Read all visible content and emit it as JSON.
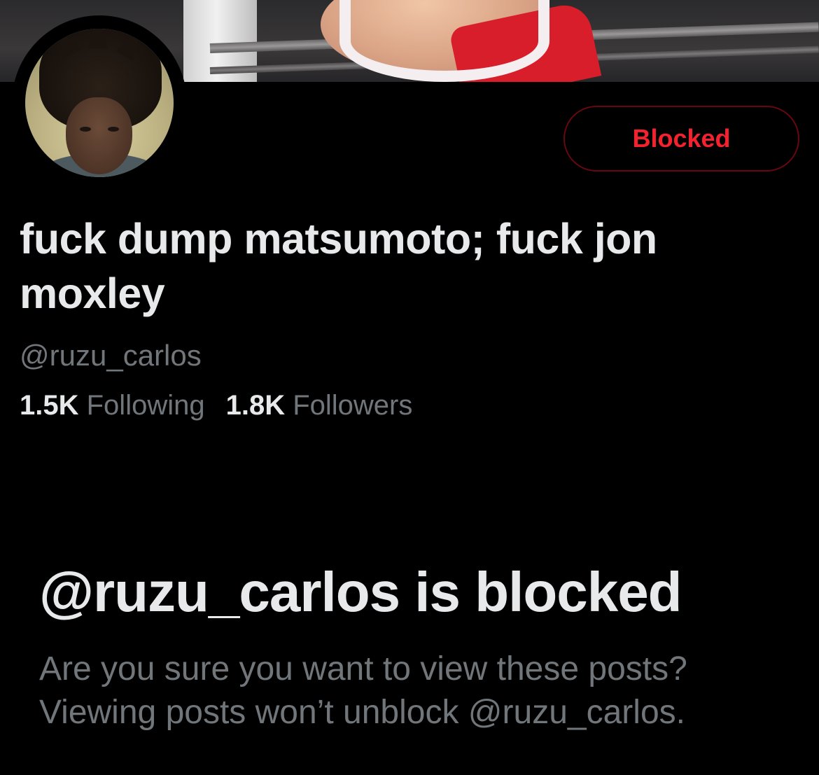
{
  "banner": {
    "image": "wrestling-ring-banner"
  },
  "profile": {
    "avatar": "profile-photo",
    "blocked_button_label": "Blocked",
    "display_name": "fuck dump matsumoto; fuck jon moxley",
    "handle": "@ruzu_carlos",
    "following_count": "1.5K",
    "following_label": "Following",
    "followers_count": "1.8K",
    "followers_label": "Followers"
  },
  "blocked_notice": {
    "title": "@ruzu_carlos is blocked",
    "description": "Are you sure you want to view these posts? Viewing posts won’t unblock @ruzu_carlos."
  },
  "colors": {
    "background": "#000000",
    "primary_text": "#e7e9ea",
    "secondary_text": "#71767b",
    "danger": "#f4212e",
    "danger_border": "#67070f"
  }
}
